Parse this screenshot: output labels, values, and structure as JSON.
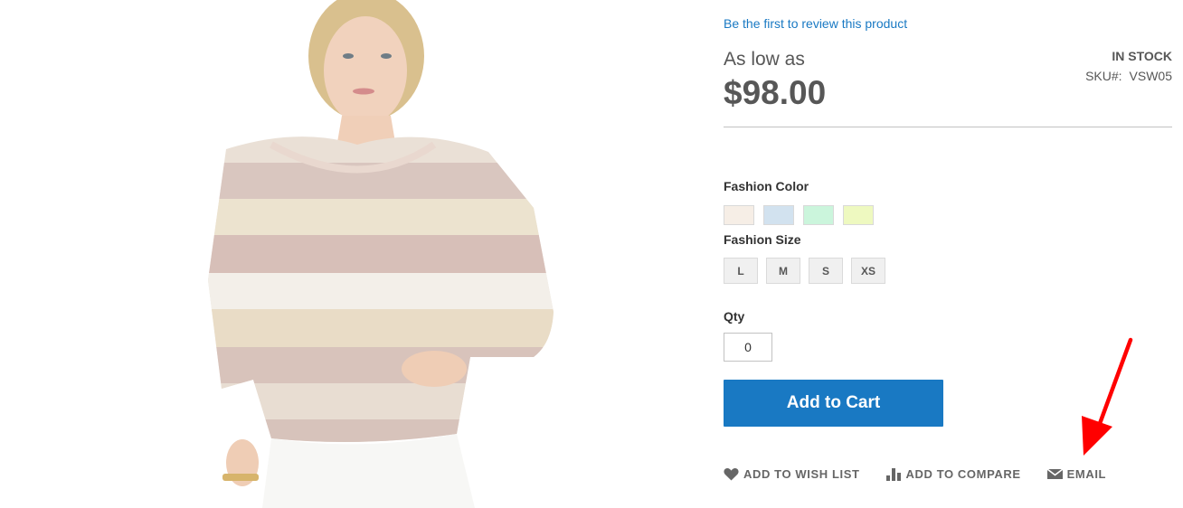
{
  "product": {
    "review_link": "Be the first to review this product",
    "price_label": "As low as",
    "price": "$98.00",
    "stock_status": "IN STOCK",
    "sku_label": "SKU#:",
    "sku_value": "VSW05"
  },
  "options": {
    "color_label": "Fashion Color",
    "colors": [
      "#f6eee6",
      "#d2e2ef",
      "#cbf5dc",
      "#eef9c0"
    ],
    "size_label": "Fashion Size",
    "sizes": [
      "L",
      "M",
      "S",
      "XS"
    ]
  },
  "qty": {
    "label": "Qty",
    "value": "0"
  },
  "cart": {
    "button_label": "Add to Cart",
    "accent_color": "#1979c3"
  },
  "actions": {
    "wishlist_label": "ADD TO WISH LIST",
    "wishlist_icon": "heart-icon",
    "compare_label": "ADD TO COMPARE",
    "compare_icon": "bar-chart-icon",
    "email_label": "EMAIL",
    "email_icon": "envelope-icon"
  },
  "annotation": {
    "arrow_color": "#ff0000"
  }
}
